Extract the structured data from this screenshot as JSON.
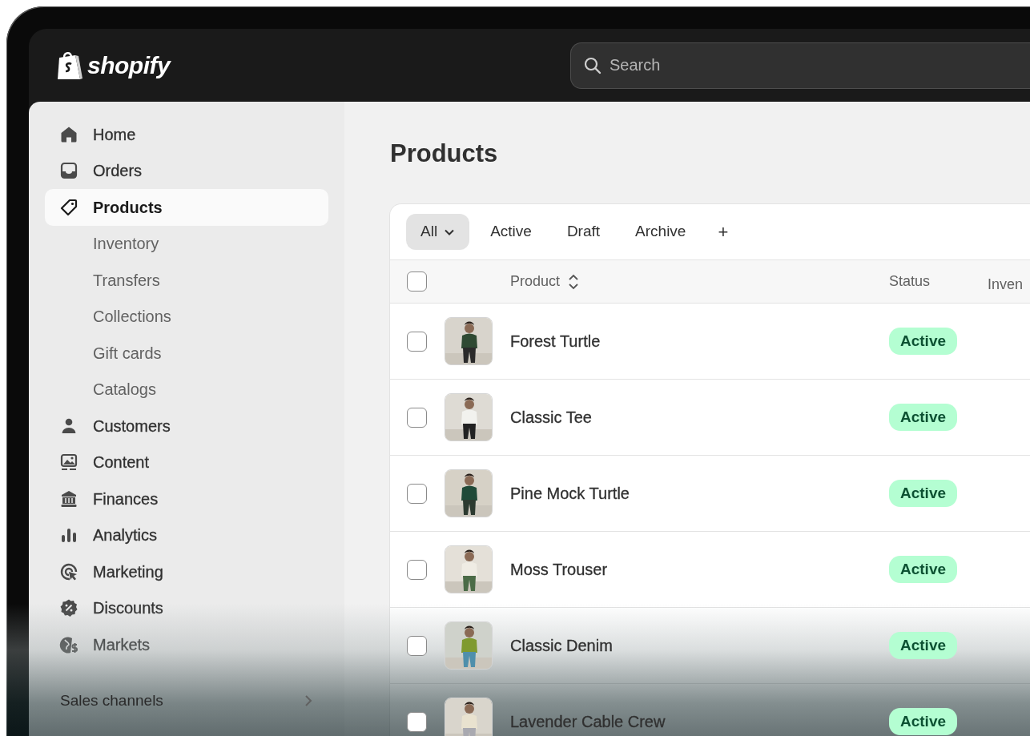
{
  "logo": {
    "text": "shopify"
  },
  "search": {
    "placeholder": "Search"
  },
  "sidebar": {
    "items": [
      {
        "label": "Home",
        "selected": false
      },
      {
        "label": "Orders",
        "selected": false
      },
      {
        "label": "Products",
        "selected": true,
        "children": [
          {
            "label": "Inventory",
            "selected": false
          },
          {
            "label": "Transfers",
            "selected": false
          },
          {
            "label": "Collections",
            "selected": false
          },
          {
            "label": "Gift cards",
            "selected": false
          },
          {
            "label": "Catalogs",
            "selected": false
          }
        ]
      },
      {
        "label": "Customers",
        "selected": false
      },
      {
        "label": "Content",
        "selected": false
      },
      {
        "label": "Finances",
        "selected": false
      },
      {
        "label": "Analytics",
        "selected": false
      },
      {
        "label": "Marketing",
        "selected": false
      },
      {
        "label": "Discounts",
        "selected": false
      },
      {
        "label": "Markets",
        "selected": false
      }
    ],
    "section": {
      "label": "Sales channels"
    }
  },
  "page": {
    "title": "Products"
  },
  "tabs": [
    {
      "label": "All",
      "selected": true
    },
    {
      "label": "Active",
      "selected": false
    },
    {
      "label": "Draft",
      "selected": false
    },
    {
      "label": "Archive",
      "selected": false
    }
  ],
  "add_view_button": {
    "label": "+"
  },
  "table": {
    "select_all": {
      "checked": false
    },
    "columns": [
      "Product",
      "Status",
      "Inven"
    ],
    "rows": [
      {
        "product": "Forest Turtle",
        "status": "Active",
        "checked": false
      },
      {
        "product": "Classic Tee",
        "status": "Active",
        "checked": false
      },
      {
        "product": "Pine Mock Turtle",
        "status": "Active",
        "checked": false
      },
      {
        "product": "Moss Trouser",
        "status": "Active",
        "checked": false
      },
      {
        "product": "Classic Denim",
        "status": "Active",
        "checked": false
      },
      {
        "product": "Lavender Cable Crew",
        "status": "Active",
        "checked": false
      }
    ]
  }
}
